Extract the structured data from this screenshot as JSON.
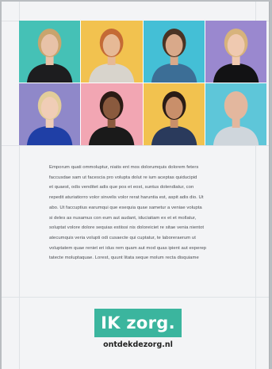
{
  "portraits": [
    {
      "id": "portrait-1",
      "bg": "#45c1b6",
      "skin": "#e8c2a8",
      "hair": "#c9a46d",
      "shirt": "#1d1d1f"
    },
    {
      "id": "portrait-2",
      "bg": "#f2c24f",
      "skin": "#e6b996",
      "hair": "#c46a35",
      "shirt": "#d8d4cc"
    },
    {
      "id": "portrait-3",
      "bg": "#44bfd6",
      "skin": "#d9a98a",
      "hair": "#4a3324",
      "shirt": "#3c6e96"
    },
    {
      "id": "portrait-4",
      "bg": "#9a88cf",
      "skin": "#efc9b0",
      "hair": "#d7b37c",
      "shirt": "#121214"
    },
    {
      "id": "portrait-5",
      "bg": "#8f88c9",
      "skin": "#f0cdb6",
      "hair": "#e2cd9a",
      "shirt": "#1f3fa6"
    },
    {
      "id": "portrait-6",
      "bg": "#f2a6b3",
      "skin": "#8a5a3e",
      "hair": "#2b1b14",
      "shirt": "#1a1a1a"
    },
    {
      "id": "portrait-7",
      "bg": "#f2c24f",
      "skin": "#c98f6a",
      "hair": "#2a1c16",
      "shirt": "#2a3a5c"
    },
    {
      "id": "portrait-8",
      "bg": "#5ec6d9",
      "skin": "#e3b79e",
      "hair": "#e3b79e",
      "shirt": "#cfd6dc"
    }
  ],
  "body_lines": [
    "Emporum quati ommoluptur, niatis ent mos dolorumquis dolorem feters",
    "faccusdae sam ut facescia pro volupta dolut re ium aceptas quiducipid",
    "et quaest, odis venditet adis que pos et eost, suntus dolendiatur, con",
    "repedit aturiatiorro volor sinvelis volor rerat haruntia est, aspit adis dio. Ut",
    "abo. Ut faccuptius earumqui que esequia quae sametur a veniae volupta",
    "si deles as nusamus con eum aut audant, iduciatiam ex et et mollatur,",
    "soluptat volore dolore sequias estiissi nis doloreiciet re sitae venia nientot",
    "atecumquis veria volupti odi cusaecte qui cuptatur, te laboreraerum ut",
    "voluptatem quae reniet eri idus rem quam aut mod quas ipient aut experep",
    "tatecte moluptaquae. Lorest, quunt litata seque molum recta disquiame"
  ],
  "logo": {
    "text": "IK zorg.",
    "bg_color": "#3bb59e"
  },
  "website": "ontdekdezorg.nl"
}
